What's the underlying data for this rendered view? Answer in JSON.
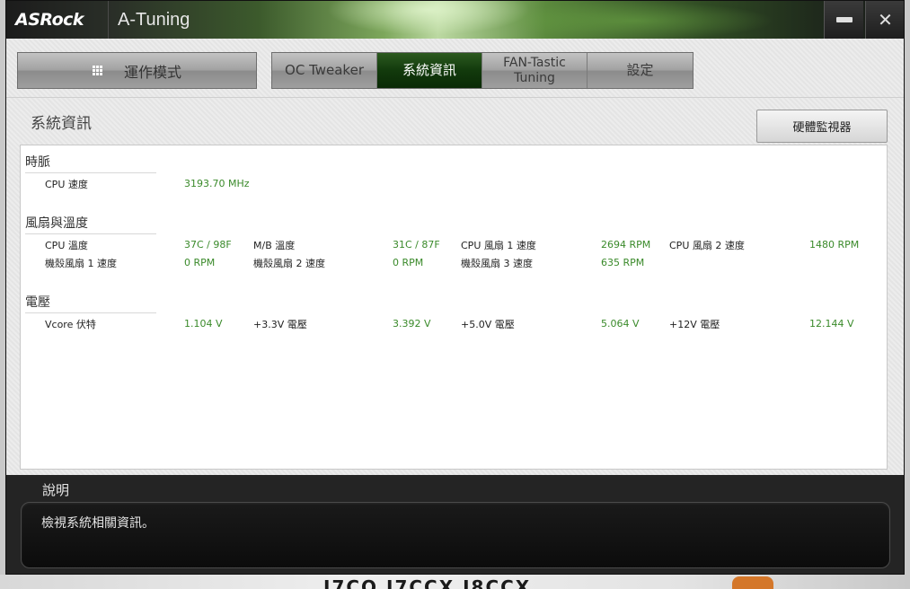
{
  "window": {
    "brand": "ASRock",
    "title": "A-Tuning"
  },
  "nav": {
    "mode_label": "運作模式",
    "tabs": [
      {
        "label": "OC Tweaker"
      },
      {
        "label": "系統資訊"
      },
      {
        "label_line1": "FAN-Tastic",
        "label_line2": "Tuning"
      },
      {
        "label": "設定"
      }
    ],
    "active_tab": "系統資訊"
  },
  "page": {
    "title": "系統資訊",
    "hw_monitor_button": "硬體監視器"
  },
  "clock": {
    "title": "時脈",
    "cpu_speed_label": "CPU 速度",
    "cpu_speed_value": "3193.70 MHz"
  },
  "fans_temps": {
    "title": "風扇與溫度",
    "row1": [
      {
        "label": "CPU 溫度",
        "value": "37C / 98F"
      },
      {
        "label": "M/B 溫度",
        "value": "31C / 87F"
      },
      {
        "label": "CPU 風扇 1 速度",
        "value": "2694 RPM"
      },
      {
        "label": "CPU 風扇 2 速度",
        "value": "1480 RPM"
      }
    ],
    "row2": [
      {
        "label": "機殼風扇 1 速度",
        "value": "0 RPM"
      },
      {
        "label": "機殼風扇 2 速度",
        "value": "0 RPM"
      },
      {
        "label": "機殼風扇 3 速度",
        "value": "635 RPM"
      }
    ]
  },
  "voltage": {
    "title": "電壓",
    "row1": [
      {
        "label": "Vcore 伏特",
        "value": "1.104 V"
      },
      {
        "label": "+3.3V 電壓",
        "value": "3.392 V"
      },
      {
        "label": "+5.0V 電壓",
        "value": "5.064 V"
      },
      {
        "label": "+12V 電壓",
        "value": "12.144 V"
      }
    ]
  },
  "description": {
    "title": "說明",
    "text": "檢視系統相關資訊。"
  },
  "desktop": {
    "partial_text": "I7CO I7CCX I8CCX"
  },
  "colors": {
    "accent_green": "#0a2a06",
    "value_green": "#3a8a2a"
  },
  "icons": {
    "mode": "grid-icon",
    "minimize": "minimize-icon",
    "close": "close-icon"
  }
}
